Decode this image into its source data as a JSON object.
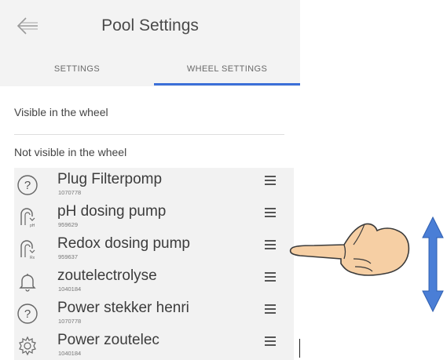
{
  "header": {
    "title": "Pool Settings",
    "back_icon": "arrow-left-icon"
  },
  "tabs": [
    {
      "label": "SETTINGS",
      "active": false
    },
    {
      "label": "WHEEL SETTINGS",
      "active": true
    }
  ],
  "colors": {
    "accent": "#3b6fd8",
    "header_bg": "#f3f3f3",
    "list_bg": "#f2f2f2"
  },
  "sections": {
    "visible_label": "Visible in the wheel",
    "not_visible_label": "Not visible in the wheel"
  },
  "devices": [
    {
      "name": "Plug Filterpomp",
      "id": "1070778",
      "icon": "question-icon"
    },
    {
      "name": "pH dosing pump",
      "id": "959629",
      "icon": "ph-pump-icon"
    },
    {
      "name": "Redox dosing pump",
      "id": "959637",
      "icon": "redox-pump-icon"
    },
    {
      "name": "zoutelectrolyse",
      "id": "1040184",
      "icon": "bell-icon"
    },
    {
      "name": "Power stekker henri",
      "id": "1070778",
      "icon": "question-icon"
    },
    {
      "name": "Power zoutelec",
      "id": "1040184",
      "icon": "gear-icon"
    }
  ]
}
